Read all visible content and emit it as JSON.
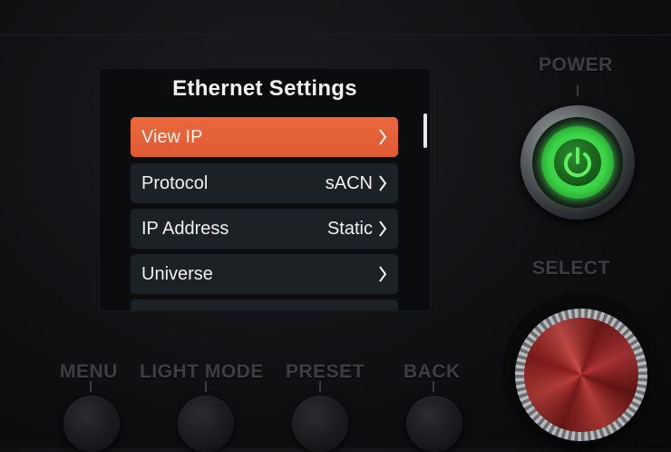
{
  "screen": {
    "title": "Ethernet Settings",
    "items": [
      {
        "label": "View IP",
        "value": "",
        "selected": true
      },
      {
        "label": "Protocol",
        "value": "sACN",
        "selected": false
      },
      {
        "label": "IP Address",
        "value": "Static",
        "selected": false
      },
      {
        "label": "Universe",
        "value": "",
        "selected": false
      }
    ]
  },
  "hardware": {
    "power_label": "POWER",
    "select_label": "SELECT",
    "buttons": [
      {
        "label": "MENU"
      },
      {
        "label": "LIGHT MODE"
      },
      {
        "label": "PRESET"
      },
      {
        "label": "BACK"
      }
    ]
  },
  "colors": {
    "selected_item": "#e5643b",
    "item_bg": "#1c2125",
    "power_led": "#3cd246",
    "knob_red": "#b8373a"
  }
}
